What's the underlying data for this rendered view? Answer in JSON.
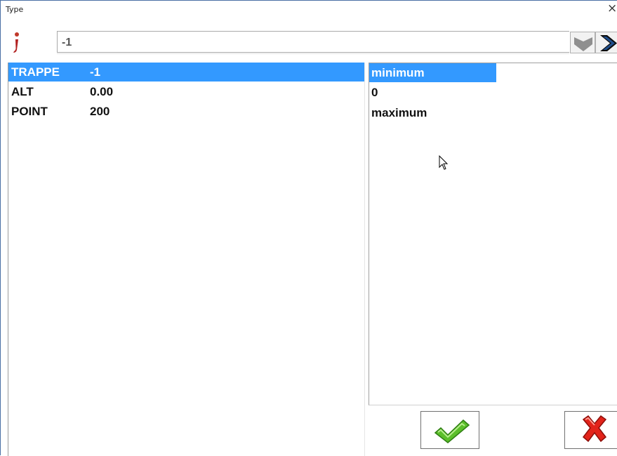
{
  "window": {
    "title": "Type",
    "close_glyph": "×"
  },
  "input": {
    "value": "-1"
  },
  "parameters": [
    {
      "name": "TRAPPE",
      "value": "-1",
      "selected": true
    },
    {
      "name": "ALT",
      "value": "0.00",
      "selected": false
    },
    {
      "name": "POINT",
      "value": "200",
      "selected": false
    }
  ],
  "value_list": [
    {
      "label": "minimum",
      "selected": true
    },
    {
      "label": "0",
      "selected": false
    },
    {
      "label": "maximum",
      "selected": false
    }
  ],
  "icons": {
    "info": "info-icon",
    "dropdown": "chevron-down-icon",
    "next": "chevron-right-icon",
    "ok": "checkmark-icon",
    "cancel": "cross-icon"
  },
  "colors": {
    "selection": "#3399ff",
    "ok_green": "#5bbf2a",
    "cancel_red": "#e2231a",
    "next_blue": "#1f4e8c"
  }
}
